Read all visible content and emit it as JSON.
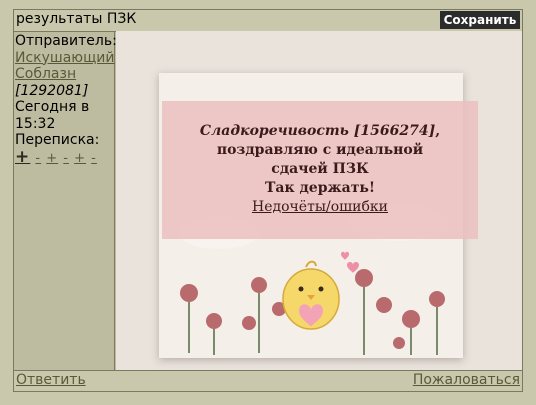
{
  "window": {
    "title": "результаты ПЗК",
    "save_label": "Сохранить"
  },
  "sidebar": {
    "sender_label": "Отправитель:",
    "sender_name_line1": "Искушающий",
    "sender_name_line2": "Соблазн",
    "sender_id": "[1292081]",
    "time_line1": "Сегодня в",
    "time_line2": "15:32",
    "correspondence_label": "Переписка:",
    "vote_plus": "+",
    "vote_rest": [
      "-",
      "+",
      "-",
      "+",
      "-"
    ]
  },
  "message": {
    "sender": "Сладкоречивость [1566274]",
    "sender_suffix": ",",
    "line2": "поздравляю с идеальной",
    "line3": "сдачей ПЗК",
    "line4": "Так держать!",
    "link": "Недочёты/ошибки"
  },
  "footer": {
    "reply": "Ответить",
    "report": "Пожаловаться"
  }
}
